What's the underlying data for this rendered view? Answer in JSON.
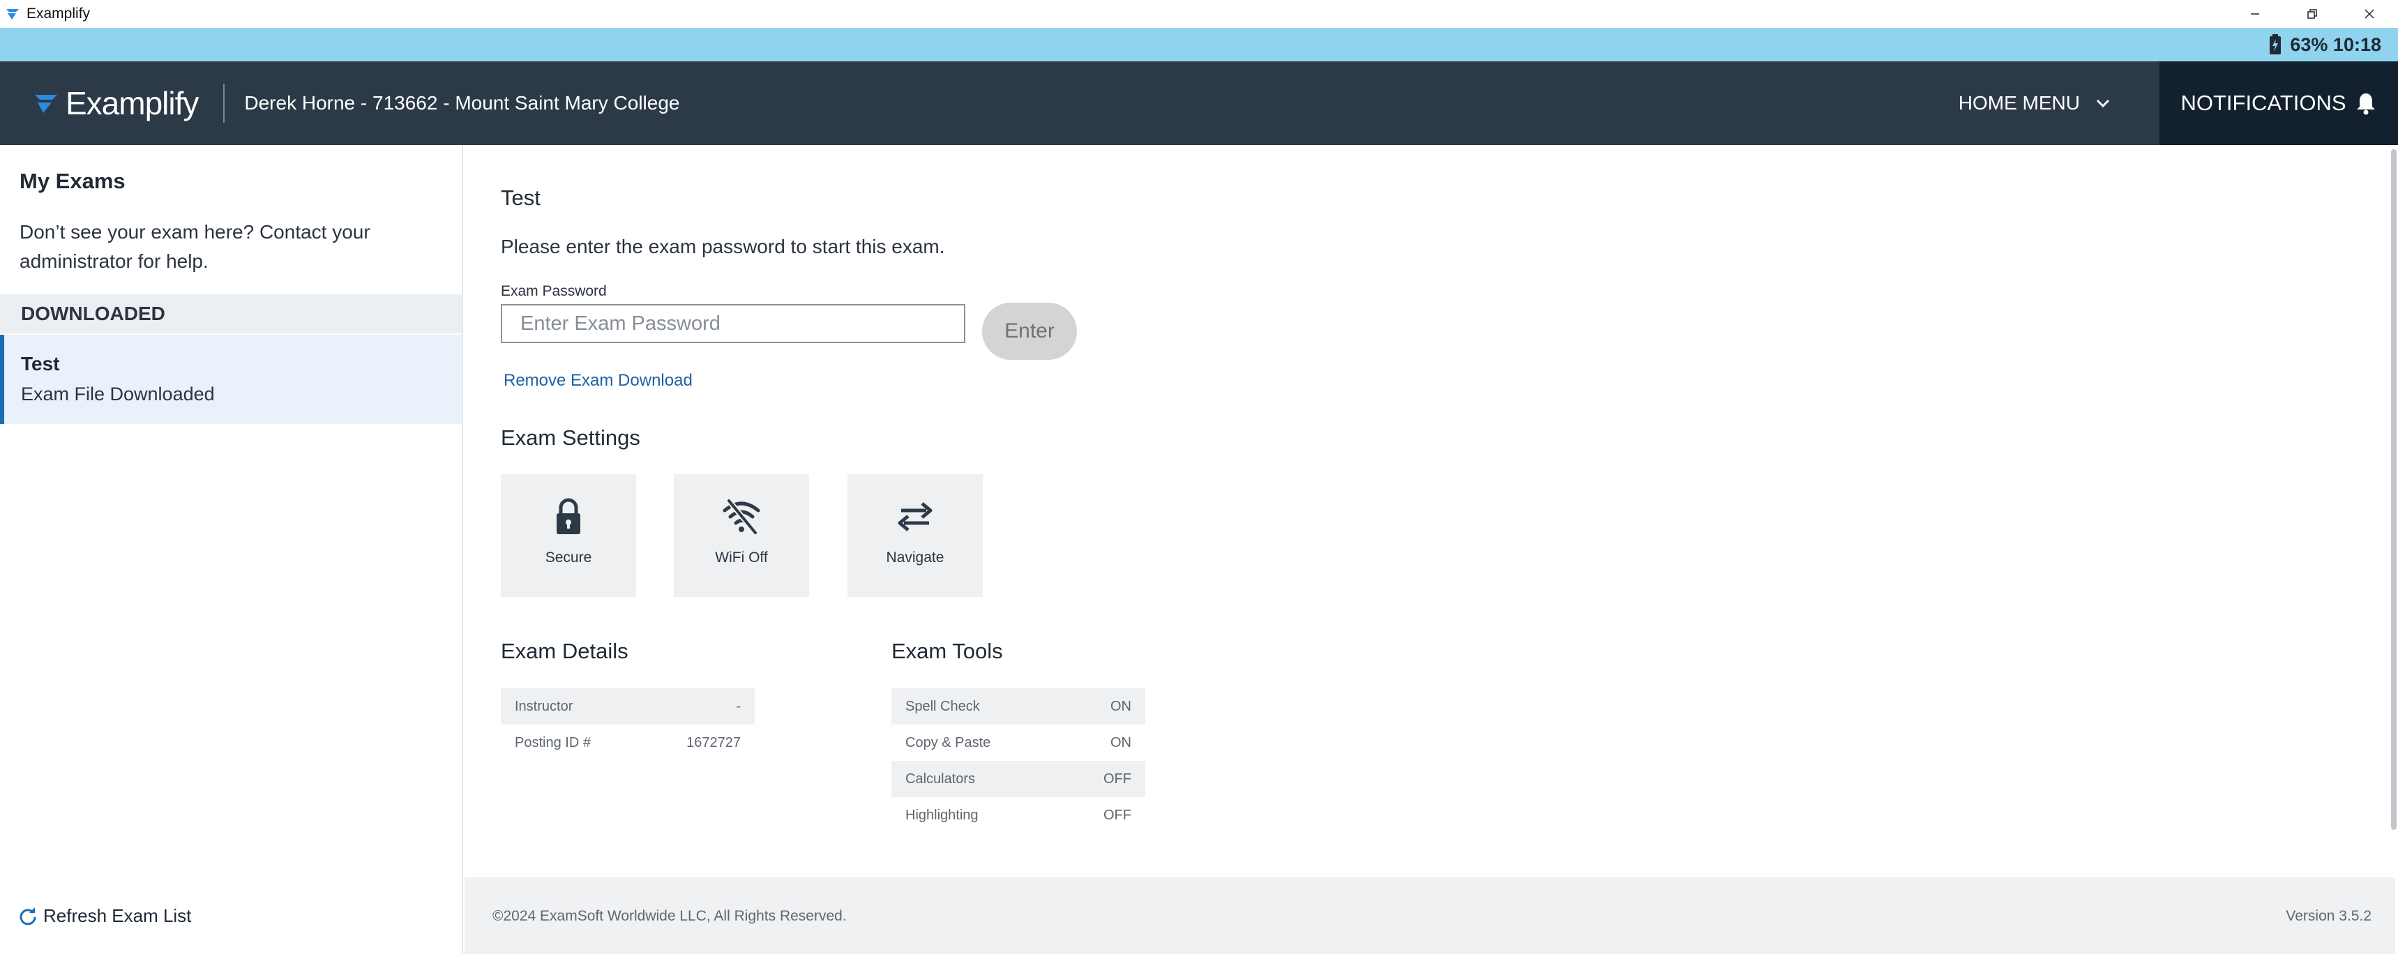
{
  "window": {
    "title": "Examplify"
  },
  "statusbar": {
    "text": "63% 10:18"
  },
  "header": {
    "logo_text": "Examplify",
    "user": "Derek Horne - 713662 - Mount Saint Mary College",
    "home_menu_label": "HOME MENU",
    "notifications_label": "NOTIFICATIONS"
  },
  "sidebar": {
    "heading": "My Exams",
    "help_text": "Don’t see your exam here? Contact your administrator for help.",
    "section_label": "DOWNLOADED",
    "exams": [
      {
        "name": "Test",
        "status": "Exam File Downloaded"
      }
    ],
    "refresh_label": "Refresh Exam List"
  },
  "main": {
    "exam_title": "Test",
    "prompt": "Please enter the exam password to start this exam.",
    "password_label": "Exam Password",
    "password_placeholder": "Enter Exam Password",
    "password_value": "",
    "enter_label": "Enter",
    "remove_link": "Remove Exam Download",
    "settings_title": "Exam Settings",
    "settings": [
      {
        "label": "Secure",
        "icon": "lock-icon"
      },
      {
        "label": "WiFi Off",
        "icon": "wifi-off-icon"
      },
      {
        "label": "Navigate",
        "icon": "navigate-arrows-icon"
      }
    ],
    "details_title": "Exam Details",
    "details": [
      {
        "key": "Instructor",
        "value": "-"
      },
      {
        "key": "Posting ID #",
        "value": "1672727"
      }
    ],
    "tools_title": "Exam Tools",
    "tools": [
      {
        "key": "Spell Check",
        "value": "ON"
      },
      {
        "key": "Copy & Paste",
        "value": "ON"
      },
      {
        "key": "Calculators",
        "value": "OFF"
      },
      {
        "key": "Highlighting",
        "value": "OFF"
      }
    ]
  },
  "footer": {
    "copyright": "©2024 ExamSoft Worldwide LLC, All Rights Reserved.",
    "version": "Version 3.5.2"
  },
  "colors": {
    "statusbar_bg": "#8fd3ee",
    "header_bg": "#2c3a47",
    "notifications_bg": "#13202d",
    "accent": "#1a6eb4",
    "link": "#1a62a6"
  }
}
